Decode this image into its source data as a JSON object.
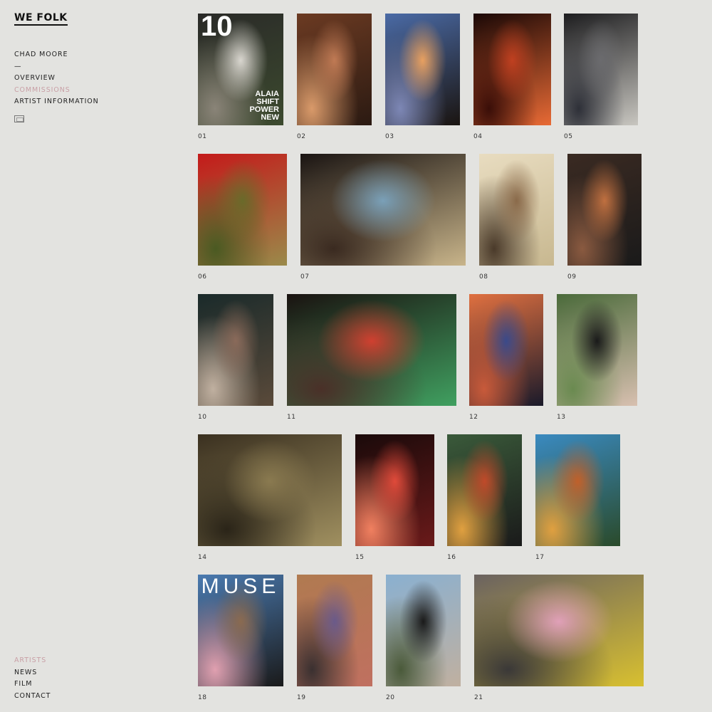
{
  "brand": {
    "logo": "WE FOLK"
  },
  "nav": {
    "artist_name": "CHAD MOORE",
    "separator": "—",
    "overview": "OVERVIEW",
    "commissions": "COMMISSIONS",
    "artist_information": "ARTIST INFORMATION"
  },
  "footer_nav": {
    "artists": "ARTISTS",
    "news": "NEWS",
    "film": "FILM",
    "contact": "CONTACT"
  },
  "colors": {
    "background": "#e3e3e0",
    "accent_active": "#c9a0a6",
    "text": "#222222"
  },
  "icons": {
    "view_toggle": "grid-view-icon"
  },
  "covers": {
    "ten_number": "10",
    "ten_lines": [
      "ALAIA",
      "SHIFT",
      "POWER",
      "NEW"
    ],
    "muse_title": "MUSE"
  },
  "photos": [
    {
      "number": "01",
      "caption": "01",
      "tones": [
        "#2a2a28",
        "#d9d6cf",
        "#3c4a2e",
        "#8a8478"
      ]
    },
    {
      "number": "02",
      "caption": "02",
      "tones": [
        "#6b3a22",
        "#c07a54",
        "#2b1a12",
        "#d99a6a"
      ]
    },
    {
      "number": "03",
      "caption": "03",
      "tones": [
        "#4a6aa5",
        "#e8a060",
        "#1a1410",
        "#7d87b5"
      ]
    },
    {
      "number": "04",
      "caption": "04",
      "tones": [
        "#1a0806",
        "#c04020",
        "#e86a35",
        "#3a0e08"
      ]
    },
    {
      "number": "05",
      "caption": "05",
      "tones": [
        "#1d1d1f",
        "#6b6b6e",
        "#c8c6c0",
        "#2e3038"
      ]
    },
    {
      "number": "06",
      "caption": "06",
      "tones": [
        "#c41a1a",
        "#6a6a2a",
        "#9a8a4a",
        "#4a5a22"
      ]
    },
    {
      "number": "07",
      "caption": "07",
      "tones": [
        "#1a1412",
        "#7aa0b8",
        "#c8b48a",
        "#3a2a20"
      ]
    },
    {
      "number": "08",
      "caption": "08",
      "tones": [
        "#e8dcc0",
        "#8a6a4a",
        "#c8b890",
        "#4a3a2a"
      ]
    },
    {
      "number": "09",
      "caption": "09",
      "tones": [
        "#3a2a22",
        "#c07040",
        "#1a1a1a",
        "#8a5a40"
      ]
    },
    {
      "number": "10",
      "caption": "10",
      "tones": [
        "#1a2a2a",
        "#8a6a5a",
        "#5a4a3a",
        "#c0b0a0"
      ]
    },
    {
      "number": "11",
      "caption": "11",
      "tones": [
        "#1a1210",
        "#d04030",
        "#40a060",
        "#4a3028"
      ]
    },
    {
      "number": "12",
      "caption": "12",
      "tones": [
        "#e07040",
        "#3a4a8a",
        "#1a1a2a",
        "#c85a3a"
      ]
    },
    {
      "number": "13",
      "caption": "13",
      "tones": [
        "#4a6a3a",
        "#1a1a1a",
        "#d8c0b0",
        "#6a8a50"
      ]
    },
    {
      "number": "14",
      "caption": "14",
      "tones": [
        "#3a3020",
        "#8a7a50",
        "#a09060",
        "#2a2418"
      ]
    },
    {
      "number": "15",
      "caption": "15",
      "tones": [
        "#1a0a0a",
        "#e04a3a",
        "#6a1a1a",
        "#f08060"
      ]
    },
    {
      "number": "16",
      "caption": "16",
      "tones": [
        "#3a5a3a",
        "#c04a2a",
        "#1a1a1a",
        "#e0a040"
      ]
    },
    {
      "number": "17",
      "caption": "17",
      "tones": [
        "#3a8ac0",
        "#c0602a",
        "#2a4a2a",
        "#e0a040"
      ]
    },
    {
      "number": "18",
      "caption": "18",
      "tones": [
        "#4a7ab0",
        "#8a6a50",
        "#1a1a1a",
        "#e0a0b0"
      ]
    },
    {
      "number": "19",
      "caption": "19",
      "tones": [
        "#b07a50",
        "#6a5a8a",
        "#c07060",
        "#3a3030"
      ]
    },
    {
      "number": "20",
      "caption": "20",
      "tones": [
        "#8ab0d0",
        "#1a1a1a",
        "#c0b0a0",
        "#4a5a3a"
      ]
    },
    {
      "number": "21",
      "caption": "21",
      "tones": [
        "#6a6260",
        "#e0a0b8",
        "#d8c030",
        "#3a3838"
      ]
    }
  ]
}
